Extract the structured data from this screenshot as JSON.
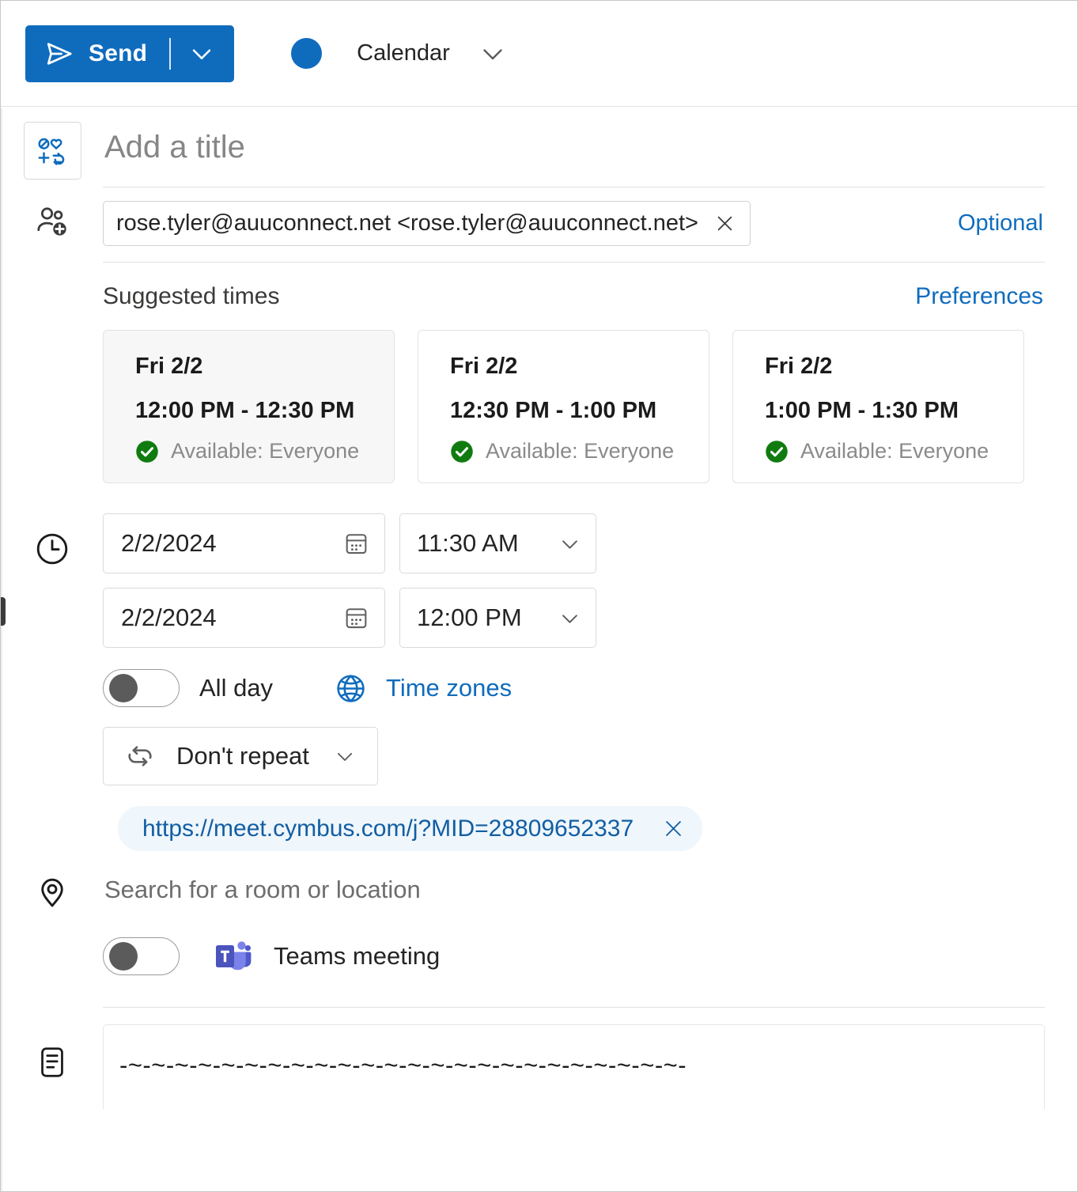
{
  "toolbar": {
    "send_label": "Send",
    "send_icon": "send-plane-icon",
    "send_caret_icon": "chevron-down-icon",
    "calendar_label": "Calendar",
    "calendar_dot_color": "#0f6cbd",
    "calendar_caret_icon": "chevron-down-icon",
    "accent_color": "#0f6cbd"
  },
  "title": {
    "icon_name": "event-icon-picker",
    "placeholder": "Add a title",
    "value": ""
  },
  "attendees": {
    "people_icon": "add-people-icon",
    "chip_text": "rose.tyler@auuconnect.net <rose.tyler@auuconnect.net>",
    "remove_icon": "close-icon",
    "optional_label": "Optional"
  },
  "suggested": {
    "heading": "Suggested times",
    "preferences_label": "Preferences",
    "cards": [
      {
        "day": "Fri 2/2",
        "time": "12:00 PM - 12:30 PM",
        "availability": "Available: Everyone",
        "selected": true
      },
      {
        "day": "Fri 2/2",
        "time": "12:30 PM - 1:00 PM",
        "availability": "Available: Everyone",
        "selected": false
      },
      {
        "day": "Fri 2/2",
        "time": "1:00 PM - 1:30 PM",
        "availability": "Available: Everyone",
        "selected": false
      }
    ],
    "available_color": "#107c10"
  },
  "datetime": {
    "clock_icon": "clock-icon",
    "start_date": "2/2/2024",
    "start_time": "11:30 AM",
    "end_date": "2/2/2024",
    "end_time": "12:00 PM",
    "calendar_icon": "calendar-picker-icon",
    "caret_icon": "chevron-down-icon",
    "all_day_label": "All day",
    "all_day_on": false,
    "timezones_label": "Time zones",
    "globe_icon": "globe-icon",
    "repeat_label": "Don't repeat",
    "repeat_icon": "repeat-icon"
  },
  "location": {
    "pin_icon": "location-pin-icon",
    "chip_url": "https://meet.cymbus.com/j?MID=28809652337",
    "chip_remove_icon": "close-icon",
    "room_placeholder": "Search for a room or location",
    "room_value": "",
    "teams_label": "Teams meeting",
    "teams_icon": "microsoft-teams-icon",
    "teams_on": false
  },
  "body": {
    "notes_icon": "notes-icon",
    "content": "-~-~-~-~-~-~-~-~-~-~-~-~-~-~-~-~-~-~-~-~-~-~-~-~-"
  }
}
